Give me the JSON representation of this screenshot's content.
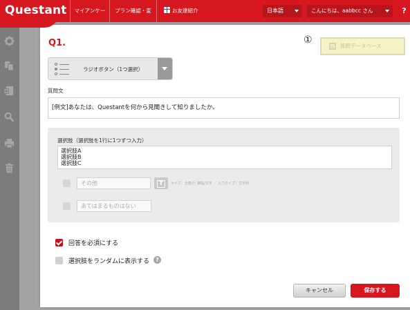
{
  "header": {
    "logo": "Questant",
    "nav": [
      "マイアンケート",
      "プラン確認・変更",
      "お友達紹介"
    ],
    "language": "日本語",
    "greeting": "こんにちは、aabbcc さん",
    "help": "?"
  },
  "sidebar": {
    "icons": [
      "gear-icon",
      "copy-icon",
      "add-page-icon",
      "search-icon",
      "print-icon",
      "trash-icon"
    ]
  },
  "question": {
    "number": "Q1.",
    "annotation": "①",
    "database_button": "質問データベース",
    "type_selected": "ラジオボタン（1つ選択）",
    "text_label": "質問文",
    "text_value": "[例文]あなたは、Questantを何から見聞きして知りましたか。"
  },
  "choices": {
    "label": "選択肢（選択肢を1行に1つずつ入力）",
    "items": [
      "選択肢A",
      "選択肢B",
      "選択肢C"
    ],
    "other_placeholder": "その他",
    "t_button": "T",
    "size_note": "サイズ：全角/行 横幅/文字 ／ 入力タイプ：文字列",
    "none_placeholder": "あてはまるものはない"
  },
  "options": {
    "required_label": "回答を必須にする",
    "required_checked": true,
    "random_label": "選択肢をランダムに表示する",
    "random_checked": false,
    "help_icon": "?"
  },
  "footer": {
    "cancel": "キャンセル",
    "save": "保存する"
  },
  "colors": {
    "brand_red": "#d7171f",
    "db_button_bg": "#f5f3c8",
    "sidebar_bg": "#7c7c7c"
  }
}
